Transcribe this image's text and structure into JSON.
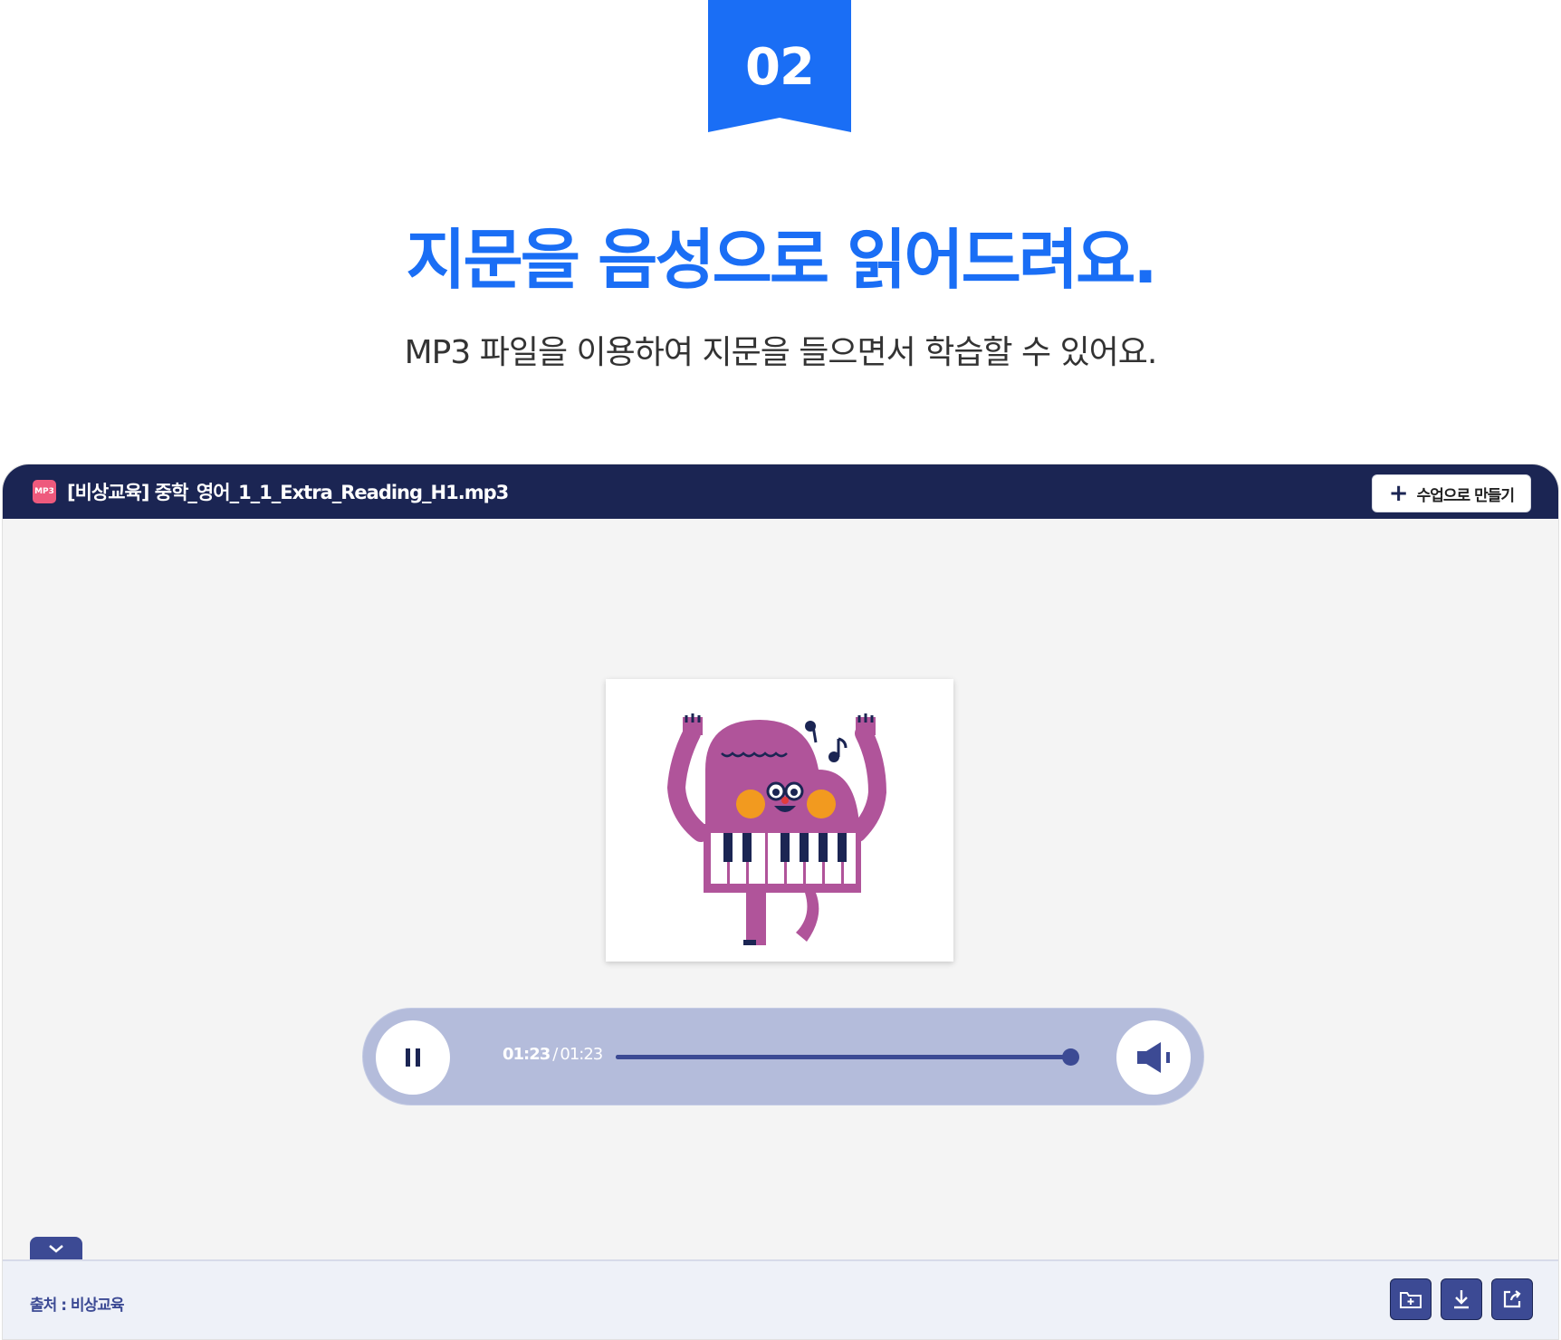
{
  "step": {
    "number": "02"
  },
  "headline": "지문을 음성으로 읽어드려요.",
  "subline": "MP3 파일을 이용하여 지문을 들으면서 학습할 수 있어요.",
  "window": {
    "file_badge": "MP3",
    "filename": "[비상교육] 중학_영어_1_1_Extra_Reading_H1.mp3",
    "make_class_label": "수업으로 만들기"
  },
  "player": {
    "current_time": "01:23",
    "separator": "/",
    "total_time": "01:23",
    "progress_fraction": 1.0,
    "state": "playing"
  },
  "footer": {
    "source": "출처 : 비상교육"
  },
  "icons": {
    "ribbon": "ribbon-badge",
    "pause": "pause-icon",
    "volume": "volume-icon",
    "collapse": "chevron-down-icon",
    "save": "folder-add-icon",
    "download": "download-icon",
    "share": "share-icon"
  },
  "colors": {
    "accent": "#1a6ef5",
    "titlebar": "#1b2553",
    "player_bg": "#b4bcdb",
    "progress": "#3c4a94",
    "badge": "#ee5a7d"
  }
}
